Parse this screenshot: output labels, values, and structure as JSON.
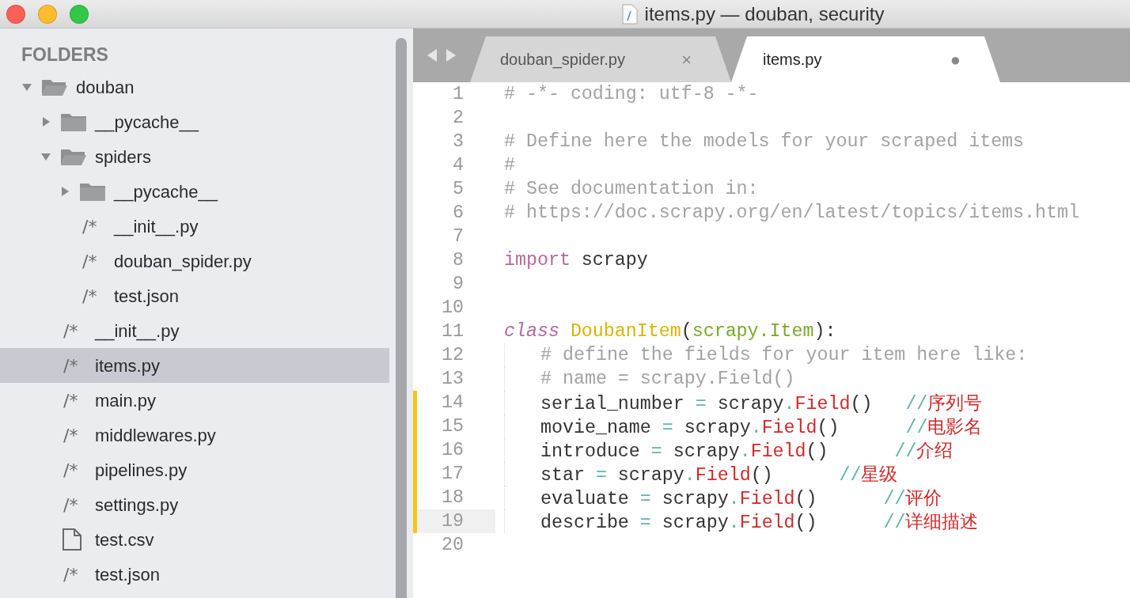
{
  "window": {
    "title": "items.py — douban, security"
  },
  "sidebar": {
    "header": "FOLDERS",
    "items": [
      {
        "kind": "folder",
        "name": "douban",
        "expanded": true,
        "selected": false,
        "children": [
          {
            "kind": "folder",
            "name": "__pycache__",
            "expanded": false,
            "selected": false
          },
          {
            "kind": "folder",
            "name": "spiders",
            "expanded": true,
            "selected": false,
            "children": [
              {
                "kind": "folder",
                "name": "__pycache__",
                "expanded": false,
                "selected": false
              },
              {
                "kind": "source",
                "glyph": "/*",
                "name": "__init__.py",
                "selected": false
              },
              {
                "kind": "source",
                "glyph": "/*",
                "name": "douban_spider.py",
                "selected": false
              },
              {
                "kind": "source",
                "glyph": "/*",
                "name": "test.json",
                "selected": false
              }
            ]
          },
          {
            "kind": "source",
            "glyph": "/*",
            "name": "__init__.py",
            "selected": false
          },
          {
            "kind": "source",
            "glyph": "/*",
            "name": "items.py",
            "selected": true
          },
          {
            "kind": "source",
            "glyph": "/*",
            "name": "main.py",
            "selected": false
          },
          {
            "kind": "source",
            "glyph": "/*",
            "name": "middlewares.py",
            "selected": false
          },
          {
            "kind": "source",
            "glyph": "/*",
            "name": "pipelines.py",
            "selected": false
          },
          {
            "kind": "source",
            "glyph": "/*",
            "name": "settings.py",
            "selected": false
          },
          {
            "kind": "document",
            "name": "test.csv",
            "selected": false
          },
          {
            "kind": "source",
            "glyph": "/*",
            "name": "test.json",
            "selected": false
          }
        ]
      }
    ]
  },
  "tabs": [
    {
      "label": "douban_spider.py",
      "selected": false,
      "marker": "×"
    },
    {
      "label": "items.py",
      "selected": true,
      "marker": "●"
    }
  ],
  "editor": {
    "lines": [
      {
        "number": "1",
        "indent": false,
        "modified": false,
        "current": false,
        "tokens": [
          {
            "kind": "comment",
            "text": "# -*- coding: utf-8 -*-"
          }
        ]
      },
      {
        "number": "2",
        "indent": false,
        "modified": false,
        "current": false
      },
      {
        "number": "3",
        "indent": false,
        "modified": false,
        "current": false,
        "tokens": [
          {
            "kind": "comment",
            "text": "# Define here the models for your scraped items"
          }
        ]
      },
      {
        "number": "4",
        "indent": false,
        "modified": false,
        "current": false,
        "tokens": [
          {
            "kind": "comment",
            "text": "#"
          }
        ]
      },
      {
        "number": "5",
        "indent": false,
        "modified": false,
        "current": false,
        "tokens": [
          {
            "kind": "comment",
            "text": "# See documentation in:"
          }
        ]
      },
      {
        "number": "6",
        "indent": false,
        "modified": false,
        "current": false,
        "tokens": [
          {
            "kind": "comment",
            "text": "# https://doc.scrapy.org/en/latest/topics/items.html"
          }
        ]
      },
      {
        "number": "7",
        "indent": false,
        "modified": false,
        "current": false
      },
      {
        "number": "8",
        "indent": false,
        "modified": false,
        "current": false,
        "tokens": [
          {
            "kind": "keyword",
            "text": "import"
          },
          {
            "kind": "plain",
            "text": " scrapy"
          }
        ]
      },
      {
        "number": "9",
        "indent": false,
        "modified": false,
        "current": false
      },
      {
        "number": "10",
        "indent": false,
        "modified": false,
        "current": false
      },
      {
        "number": "11",
        "indent": false,
        "modified": false,
        "current": false,
        "tokens": [
          {
            "kind": "storage",
            "text": "class"
          },
          {
            "kind": "entity",
            "text": " DoubanItem"
          },
          {
            "kind": "plain",
            "text": "("
          },
          {
            "kind": "inherit",
            "text": "scrapy.Item"
          },
          {
            "kind": "plain",
            "text": "):"
          }
        ]
      },
      {
        "number": "12",
        "indent": true,
        "modified": false,
        "current": false,
        "tokens": [
          {
            "kind": "comment",
            "text": "# define the fields for your item here like:"
          }
        ]
      },
      {
        "number": "13",
        "indent": true,
        "modified": false,
        "current": false,
        "tokens": [
          {
            "kind": "comment",
            "text": "# name = scrapy.Field()"
          }
        ]
      },
      {
        "number": "14",
        "indent": true,
        "modified": true,
        "current": false,
        "tokens": [
          {
            "kind": "plain",
            "text": "serial_number "
          },
          {
            "kind": "operator",
            "text": "="
          },
          {
            "kind": "plain",
            "text": " scrapy"
          },
          {
            "kind": "operator",
            "text": "."
          },
          {
            "kind": "function",
            "text": "Field"
          },
          {
            "kind": "plain",
            "text": "()"
          },
          {
            "kind": "slash",
            "text": "   //"
          },
          {
            "kind": "cjk",
            "text": "序列号"
          }
        ]
      },
      {
        "number": "15",
        "indent": true,
        "modified": true,
        "current": false,
        "tokens": [
          {
            "kind": "plain",
            "text": "movie_name "
          },
          {
            "kind": "operator",
            "text": "="
          },
          {
            "kind": "plain",
            "text": " scrapy"
          },
          {
            "kind": "operator",
            "text": "."
          },
          {
            "kind": "function",
            "text": "Field"
          },
          {
            "kind": "plain",
            "text": "()"
          },
          {
            "kind": "slash",
            "text": "      //"
          },
          {
            "kind": "cjk",
            "text": "电影名"
          }
        ]
      },
      {
        "number": "16",
        "indent": true,
        "modified": true,
        "current": false,
        "tokens": [
          {
            "kind": "plain",
            "text": "introduce "
          },
          {
            "kind": "operator",
            "text": "="
          },
          {
            "kind": "plain",
            "text": " scrapy"
          },
          {
            "kind": "operator",
            "text": "."
          },
          {
            "kind": "function",
            "text": "Field"
          },
          {
            "kind": "plain",
            "text": "()"
          },
          {
            "kind": "slash",
            "text": "      //"
          },
          {
            "kind": "cjk",
            "text": "介绍"
          }
        ]
      },
      {
        "number": "17",
        "indent": true,
        "modified": true,
        "current": false,
        "tokens": [
          {
            "kind": "plain",
            "text": "star "
          },
          {
            "kind": "operator",
            "text": "="
          },
          {
            "kind": "plain",
            "text": " scrapy"
          },
          {
            "kind": "operator",
            "text": "."
          },
          {
            "kind": "function",
            "text": "Field"
          },
          {
            "kind": "plain",
            "text": "()"
          },
          {
            "kind": "slash",
            "text": "      //"
          },
          {
            "kind": "cjk",
            "text": "星级"
          }
        ]
      },
      {
        "number": "18",
        "indent": true,
        "modified": true,
        "current": false,
        "tokens": [
          {
            "kind": "plain",
            "text": "evaluate "
          },
          {
            "kind": "operator",
            "text": "="
          },
          {
            "kind": "plain",
            "text": " scrapy"
          },
          {
            "kind": "operator",
            "text": "."
          },
          {
            "kind": "function",
            "text": "Field"
          },
          {
            "kind": "plain",
            "text": "()"
          },
          {
            "kind": "slash",
            "text": "      //"
          },
          {
            "kind": "cjk",
            "text": "评价"
          }
        ]
      },
      {
        "number": "19",
        "indent": true,
        "modified": true,
        "current": true,
        "tokens": [
          {
            "kind": "plain",
            "text": "describe "
          },
          {
            "kind": "operator",
            "text": "="
          },
          {
            "kind": "plain",
            "text": " scrapy"
          },
          {
            "kind": "operator",
            "text": "."
          },
          {
            "kind": "function",
            "text": "Field"
          },
          {
            "kind": "plain",
            "text": "()"
          },
          {
            "kind": "slash",
            "text": "      //"
          },
          {
            "kind": "cjk",
            "text": "详细描述"
          }
        ]
      },
      {
        "number": "20",
        "indent": false,
        "modified": false,
        "current": false
      }
    ]
  }
}
